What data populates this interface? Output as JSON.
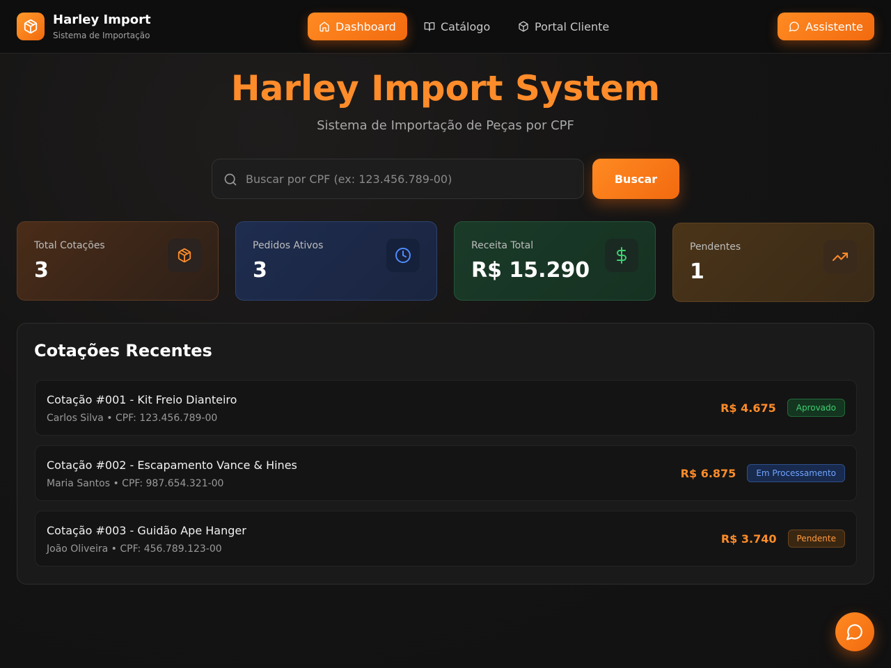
{
  "header": {
    "brand_name": "Harley Import",
    "brand_subtitle": "Sistema de Importação",
    "nav": [
      {
        "label": "Dashboard",
        "icon": "home-icon",
        "active": true
      },
      {
        "label": "Catálogo",
        "icon": "book-open-icon",
        "active": false
      },
      {
        "label": "Portal Cliente",
        "icon": "package-icon",
        "active": false
      }
    ],
    "assistant_label": "Assistente"
  },
  "hero": {
    "title": "Harley Import System",
    "subtitle": "Sistema de Importação de Peças por CPF"
  },
  "search": {
    "placeholder": "Buscar por CPF (ex: 123.456.789-00)",
    "value": "",
    "button_label": "Buscar"
  },
  "stats": [
    {
      "label": "Total Cotações",
      "value": "3",
      "icon": "package-icon",
      "color": "#ff8c2a"
    },
    {
      "label": "Pedidos Ativos",
      "value": "3",
      "icon": "clock-icon",
      "color": "#4f8cff"
    },
    {
      "label": "Receita Total",
      "value": "R$ 15.290",
      "icon": "dollar-icon",
      "color": "#3fcf72"
    },
    {
      "label": "Pendentes",
      "value": "1",
      "icon": "trending-up-icon",
      "color": "#ff8c2a"
    }
  ],
  "recent": {
    "title": "Cotações Recentes",
    "items": [
      {
        "title": "Cotação #001 - Kit Freio Dianteiro",
        "subtitle": "Carlos Silva • CPF: 123.456.789-00",
        "amount": "R$ 4.675",
        "status": "Aprovado"
      },
      {
        "title": "Cotação #002 - Escapamento Vance & Hines",
        "subtitle": "Maria Santos • CPF: 987.654.321-00",
        "amount": "R$ 6.875",
        "status": "Em Processamento"
      },
      {
        "title": "Cotação #003 - Guidão Ape Hanger",
        "subtitle": "João Oliveira • CPF: 456.789.123-00",
        "amount": "R$ 3.740",
        "status": "Pendente"
      }
    ]
  },
  "colors": {
    "accent": "#f26a0f",
    "accent_light": "#ff8c2a",
    "background": "#151414"
  }
}
